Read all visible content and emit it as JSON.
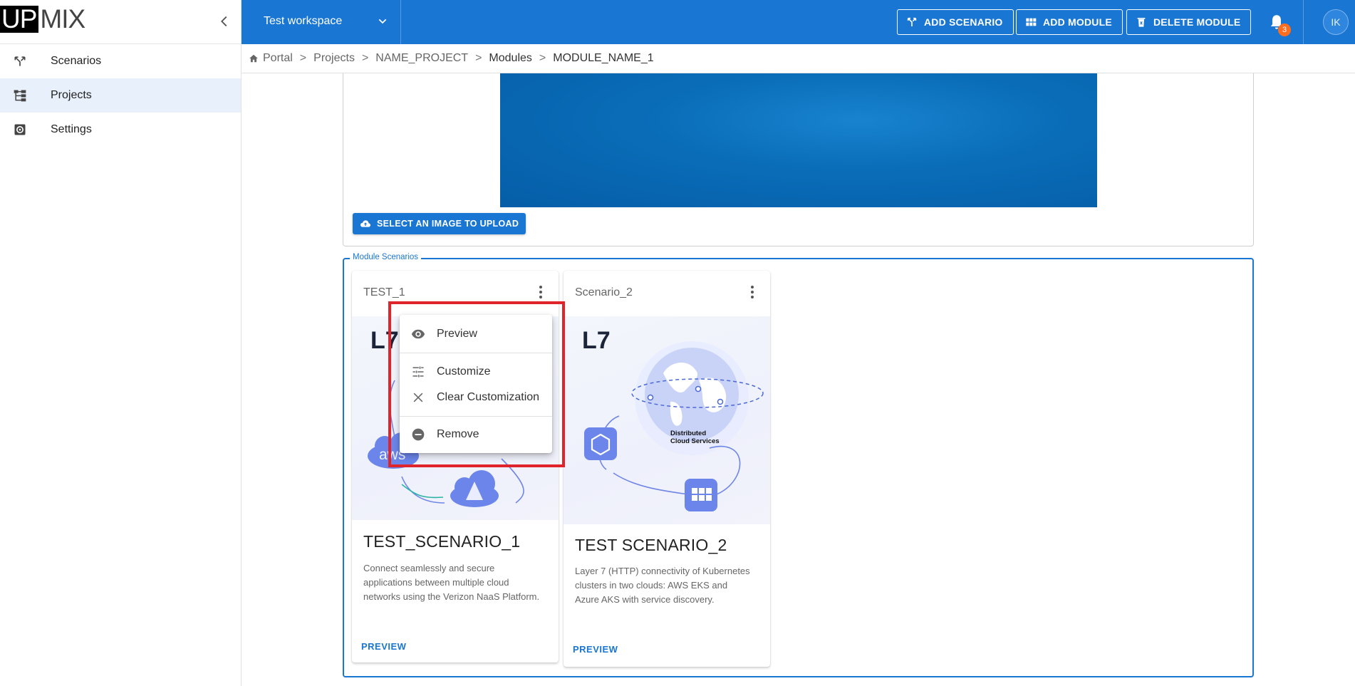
{
  "sidebar": {
    "logo_inverse": "UP",
    "logo_rest": "MIX",
    "items": [
      {
        "label": "Scenarios",
        "icon": "scenarios-icon",
        "active": false
      },
      {
        "label": "Projects",
        "icon": "projects-icon",
        "active": true
      },
      {
        "label": "Settings",
        "icon": "settings-icon",
        "active": false
      }
    ]
  },
  "topbar": {
    "workspace": "Test workspace",
    "add_scenario": "ADD SCENARIO",
    "add_module": "ADD MODULE",
    "delete_module": "DELETE MODULE",
    "notifications_count": "3",
    "avatar_initials": "IK",
    "accent": "#1976d2"
  },
  "breadcrumb": {
    "items": [
      "Portal",
      "Projects",
      "NAME_PROJECT",
      "Modules",
      "MODULE_NAME_1"
    ],
    "separator": ">"
  },
  "main": {
    "upload_button": "SELECT AN IMAGE TO UPLOAD",
    "module_scenarios_legend": "Module Scenarios",
    "cards": [
      {
        "header": "TEST_1",
        "image_label": "L7",
        "image_badge": "aws",
        "title": "TEST_SCENARIO_1",
        "description": "Connect seamlessly and secure applications between multiple cloud networks using the Verizon NaaS Platform.",
        "link": "PREVIEW"
      },
      {
        "header": "Scenario_2",
        "image_label": "L7",
        "image_caption_line1": "Distributed",
        "image_caption_line2": "Cloud Services",
        "title": "TEST SCENARIO_2",
        "description": "Layer 7 (HTTP) connectivity of Kubernetes clusters in two clouds: AWS EKS and Azure AKS with service discovery.",
        "link": "PREVIEW"
      }
    ]
  },
  "context_menu": {
    "items": [
      {
        "label": "Preview",
        "icon": "eye-icon"
      },
      {
        "label": "Customize",
        "icon": "tune-icon"
      },
      {
        "label": "Clear Customization",
        "icon": "close-icon"
      },
      {
        "label": "Remove",
        "icon": "remove-circle-icon"
      }
    ],
    "highlight_color": "#e0242b"
  }
}
